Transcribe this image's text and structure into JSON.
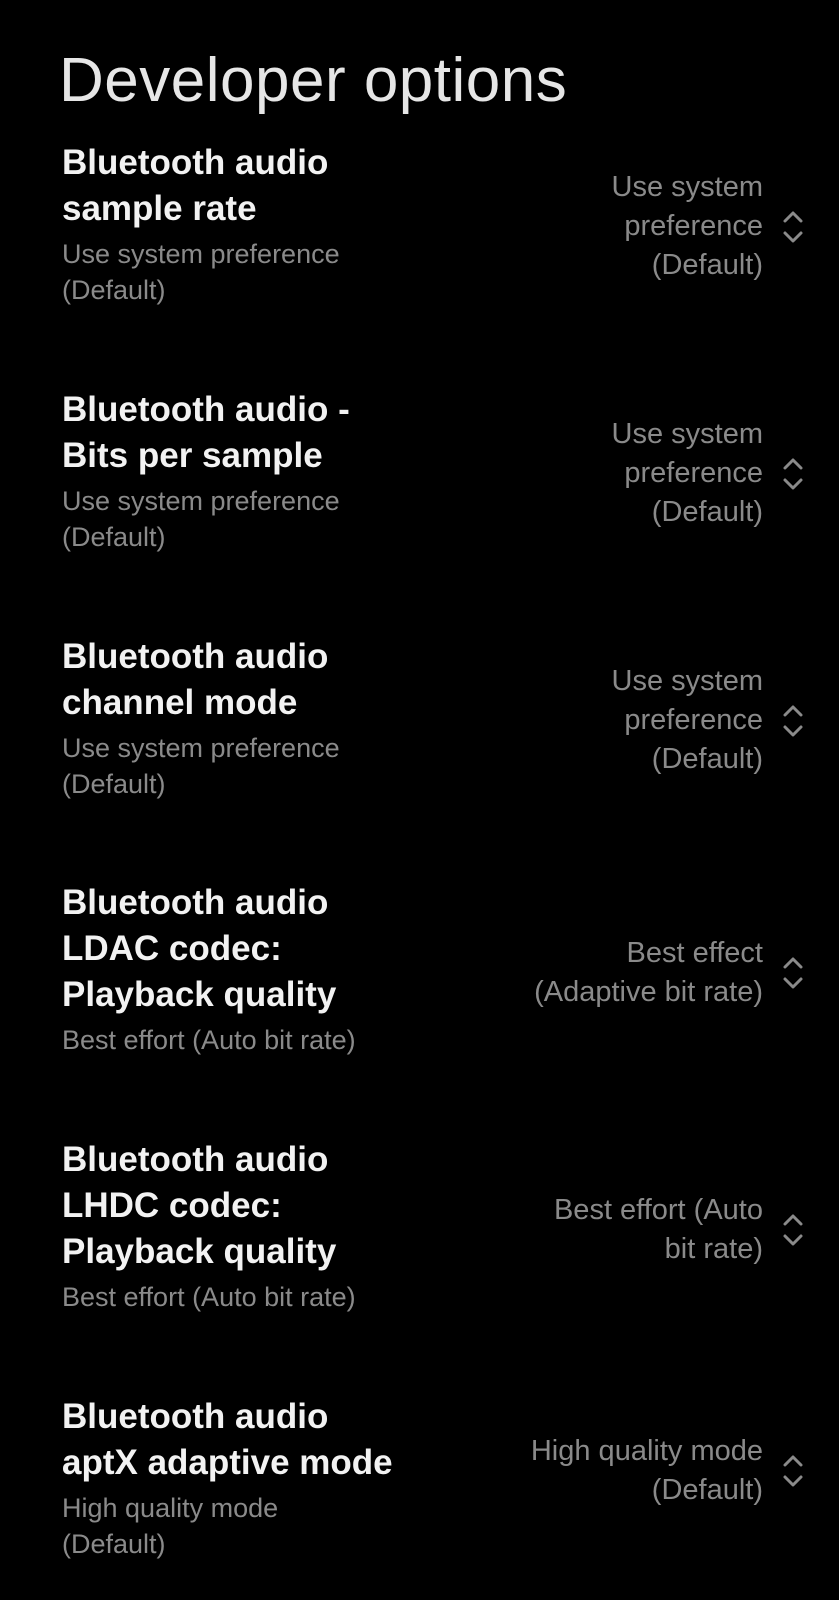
{
  "page": {
    "title": "Developer options"
  },
  "settings": [
    {
      "title": "Bluetooth audio\nsample rate",
      "summary": "Use system preference\n(Default)",
      "value": "Use system\npreference\n(Default)",
      "icon": "chevron-up-down-icon"
    },
    {
      "title": "Bluetooth audio -\nBits per sample",
      "summary": "Use system preference\n(Default)",
      "value": "Use system\npreference\n(Default)",
      "icon": "chevron-up-down-icon"
    },
    {
      "title": "Bluetooth audio\nchannel mode",
      "summary": "Use system preference\n(Default)",
      "value": "Use system\npreference\n(Default)",
      "icon": "chevron-up-down-icon"
    },
    {
      "title": "Bluetooth audio\nLDAC codec:\nPlayback quality",
      "summary": "Best effort (Auto bit rate)",
      "value": "Best effect\n(Adaptive bit rate)",
      "icon": "chevron-up-down-icon"
    },
    {
      "title": "Bluetooth audio\nLHDC codec:\nPlayback quality",
      "summary": "Best effort (Auto bit rate)",
      "value": "Best effort (Auto\nbit rate)",
      "icon": "chevron-up-down-icon"
    },
    {
      "title": "Bluetooth audio\naptX adaptive mode",
      "summary": "High quality mode\n(Default)",
      "value": "High quality mode\n(Default)",
      "icon": "chevron-up-down-icon"
    }
  ],
  "colors": {
    "background": "#000000",
    "title_text": "#f2f2f2",
    "secondary_text": "#8a8a8a"
  }
}
